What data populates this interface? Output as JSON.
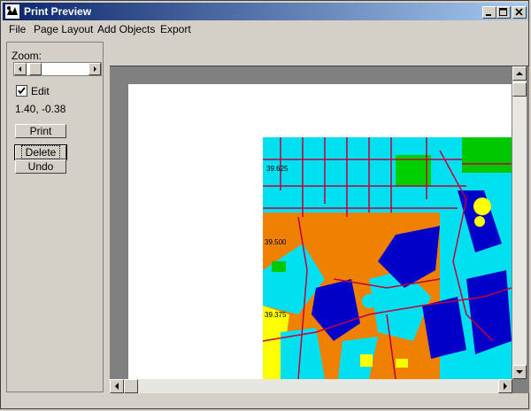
{
  "window": {
    "title": "Print Preview",
    "controls": [
      "minimize-icon",
      "maximize-icon",
      "close-icon"
    ]
  },
  "menubar": {
    "items": [
      "File",
      "Page Layout",
      "Add Objects",
      "Export"
    ]
  },
  "sidebar": {
    "zoom_label": "Zoom:",
    "zoom_slider_position": 0.2,
    "edit_label": "Edit",
    "edit_checked": true,
    "coordinates": "1.40, -0.38",
    "print_label": "Print",
    "delete_label": "Delete",
    "undo_label": "Undo"
  },
  "preview": {
    "map_labels": [
      "39.625",
      "39.500",
      "39.375"
    ],
    "colors": {
      "water_cyan": "#00e0f0",
      "urban_orange": "#f08000",
      "deep_blue": "#0000c8",
      "green": "#00d000",
      "yellow": "#ffff00",
      "roads": "#c00040"
    }
  }
}
